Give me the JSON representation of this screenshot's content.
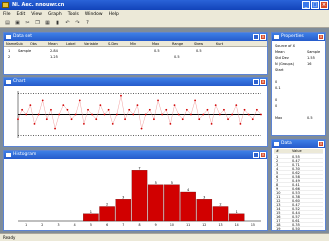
{
  "window": {
    "title": "Ni. Aec. nnouwr.cn",
    "min": "_",
    "max": "□",
    "close": "×"
  },
  "menu": [
    "File",
    "Edit",
    "View",
    "Graph",
    "Tools",
    "Window",
    "Help"
  ],
  "toolbar_icons": [
    "open-icon",
    "save-icon",
    "cut-icon",
    "copy-icon",
    "paste-icon",
    "chart-icon",
    "undo-icon",
    "redo-icon",
    "help-icon"
  ],
  "panels": {
    "table": {
      "title": "Data set"
    },
    "line": {
      "title": "Chart"
    },
    "hist": {
      "title": "Histogram"
    },
    "props": {
      "title": "Properties"
    },
    "data": {
      "title": "Data"
    }
  },
  "table": {
    "headers": [
      "Name",
      "Sub",
      "Obs",
      "Mean",
      "Label",
      "Variable",
      "S.Dev",
      "Min",
      "Max",
      "Range",
      "Skew",
      "Kurt"
    ],
    "rows": [
      [
        "1",
        "Sample",
        "",
        "2.84",
        "",
        "",
        "",
        "",
        "0.5",
        "",
        "0.5",
        ""
      ],
      [
        "2",
        "",
        "",
        "1.25",
        "",
        "",
        "",
        "",
        "",
        "0.5",
        "",
        ""
      ]
    ]
  },
  "props": [
    [
      "Source of X",
      ""
    ],
    [
      "Mean",
      "Sample"
    ],
    [
      "Std Dev",
      "1.55"
    ],
    [
      "N (Groups)",
      "16"
    ],
    [
      "Start",
      ""
    ],
    [
      "",
      ""
    ],
    [
      "0",
      ""
    ],
    [
      "0.1",
      ""
    ],
    [
      "",
      ""
    ],
    [
      "0",
      ""
    ],
    [
      "0",
      ""
    ],
    [
      "",
      ""
    ],
    [
      "Max",
      "0.5"
    ],
    [
      "",
      ""
    ]
  ],
  "datalist": {
    "header": [
      "#",
      "Value"
    ],
    "rows": [
      [
        "1",
        "0.55"
      ],
      [
        "2",
        "0.47"
      ],
      [
        "3",
        "0.71"
      ],
      [
        "4",
        "0.30"
      ],
      [
        "5",
        "0.62"
      ],
      [
        "6",
        "0.58"
      ],
      [
        "7",
        "0.49"
      ],
      [
        "8",
        "0.41"
      ],
      [
        "9",
        "0.66"
      ],
      [
        "10",
        "0.53"
      ],
      [
        "11",
        "0.38"
      ],
      [
        "12",
        "0.60"
      ],
      [
        "13",
        "0.47"
      ],
      [
        "14",
        "0.52"
      ],
      [
        "15",
        "0.44"
      ],
      [
        "16",
        "0.57"
      ],
      [
        "17",
        "0.61"
      ],
      [
        "18",
        "0.35"
      ],
      [
        "19",
        "0.50"
      ]
    ]
  },
  "status": "Ready",
  "colors": {
    "bar": "#d10000",
    "points": "#d10000",
    "limit": "#000000"
  },
  "chart_data": [
    {
      "type": "line",
      "x": [
        1,
        2,
        3,
        4,
        5,
        6,
        7,
        8,
        9,
        10,
        11,
        12,
        13,
        14,
        15,
        16,
        17,
        18,
        19,
        20,
        21,
        22,
        23,
        24,
        25,
        26,
        27,
        28,
        29,
        30,
        31,
        32,
        33,
        34,
        35,
        36,
        37,
        38,
        39,
        40,
        41,
        42,
        43,
        44,
        45,
        46,
        47,
        48,
        49,
        50,
        51,
        52,
        53,
        54,
        55,
        56,
        57,
        58,
        59,
        60
      ],
      "values": [
        0.4,
        0.6,
        0.5,
        0.7,
        0.3,
        0.5,
        0.8,
        0.4,
        0.6,
        0.2,
        0.5,
        0.7,
        0.6,
        0.4,
        0.5,
        0.8,
        0.3,
        0.6,
        0.5,
        0.4,
        0.7,
        0.5,
        0.6,
        0.3,
        0.5,
        0.9,
        0.4,
        0.6,
        0.5,
        0.7,
        0.2,
        0.5,
        0.6,
        0.4,
        0.8,
        0.5,
        0.6,
        0.3,
        0.7,
        0.5,
        0.4,
        0.6,
        0.5,
        0.8,
        0.4,
        0.5,
        0.6,
        0.3,
        0.7,
        0.5,
        0.6,
        0.4,
        0.5,
        0.7,
        0.3,
        0.6,
        0.5,
        0.4,
        0.6,
        0.5
      ],
      "center": 0.5,
      "ucl": 0.95,
      "lcl": 0.05,
      "ylim": [
        0,
        1
      ],
      "grid": false
    },
    {
      "type": "bar",
      "categories": [
        "1",
        "2",
        "3",
        "4",
        "5",
        "6",
        "7",
        "8",
        "9",
        "10",
        "11",
        "12",
        "13",
        "14",
        "15"
      ],
      "values": [
        0,
        0,
        0,
        0,
        1,
        2,
        3,
        7,
        5,
        5,
        4,
        3,
        2,
        1,
        0
      ],
      "ylim": [
        0,
        8
      ]
    }
  ]
}
